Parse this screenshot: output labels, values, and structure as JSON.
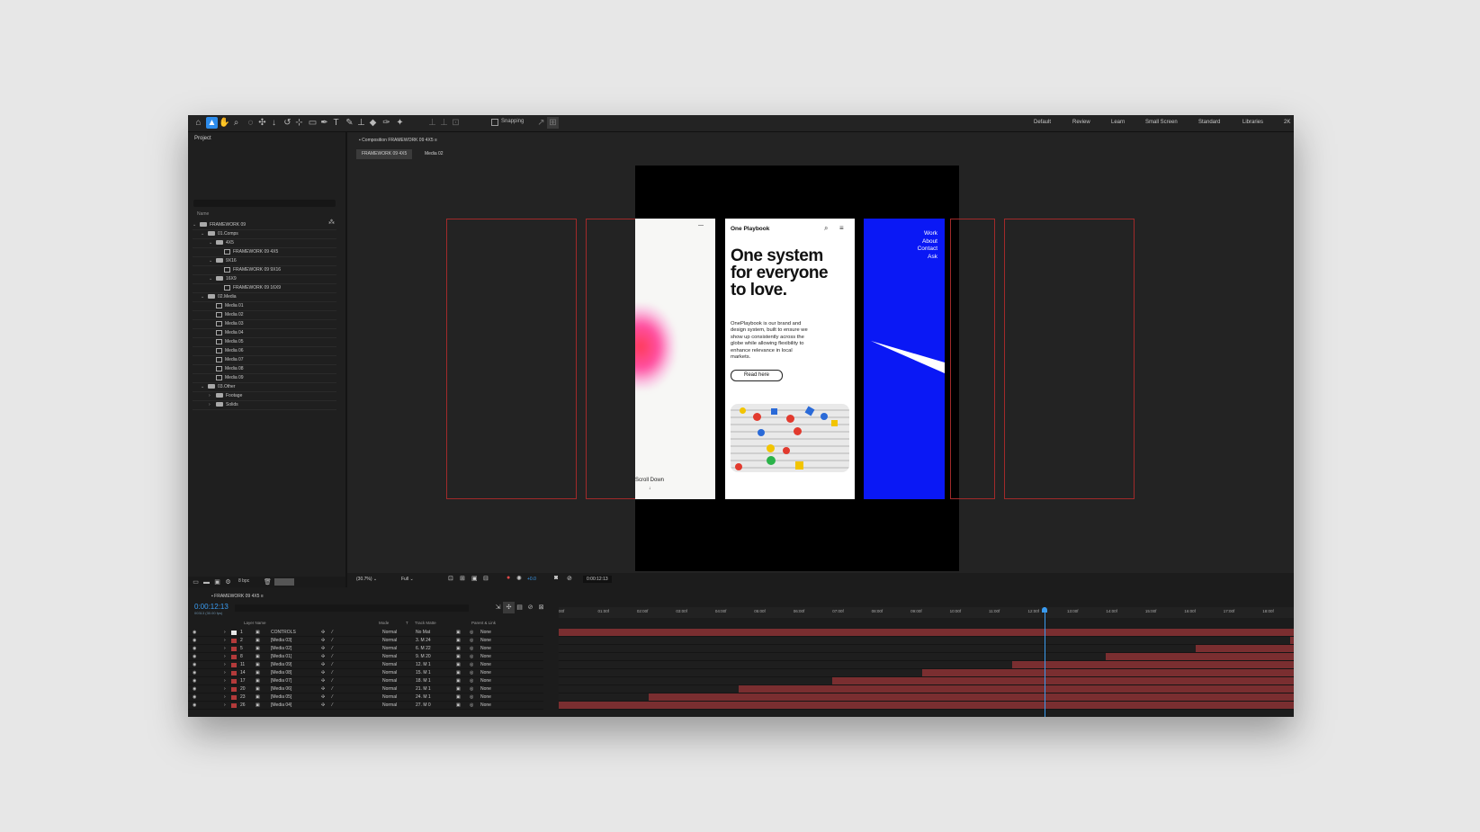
{
  "toolbar": {
    "snapping": "Snapping",
    "workspaces": [
      "Default",
      "Review",
      "Learn",
      "Small Screen",
      "Standard",
      "Libraries",
      "2K"
    ]
  },
  "project": {
    "title": "Project",
    "name_col": "Name",
    "tree": [
      {
        "label": "FRAMEWORK 09",
        "indent": 0,
        "type": "folder",
        "open": true
      },
      {
        "label": "01.Comps",
        "indent": 1,
        "type": "folder",
        "open": true
      },
      {
        "label": "4X5",
        "indent": 2,
        "type": "folder",
        "open": true
      },
      {
        "label": "FRAMEWORK 09 4X5",
        "indent": 3,
        "type": "comp"
      },
      {
        "label": "9X16",
        "indent": 2,
        "type": "folder",
        "open": true
      },
      {
        "label": "FRAMEWORK 09 9X16",
        "indent": 3,
        "type": "comp"
      },
      {
        "label": "16X9",
        "indent": 2,
        "type": "folder",
        "open": true
      },
      {
        "label": "FRAMEWORK 09 16X9",
        "indent": 3,
        "type": "comp"
      },
      {
        "label": "02.Media",
        "indent": 1,
        "type": "folder",
        "open": true
      },
      {
        "label": "Media 01",
        "indent": 2,
        "type": "comp"
      },
      {
        "label": "Media 02",
        "indent": 2,
        "type": "comp"
      },
      {
        "label": "Media 03",
        "indent": 2,
        "type": "comp"
      },
      {
        "label": "Media 04",
        "indent": 2,
        "type": "comp"
      },
      {
        "label": "Media 05",
        "indent": 2,
        "type": "comp"
      },
      {
        "label": "Media 06",
        "indent": 2,
        "type": "comp"
      },
      {
        "label": "Media 07",
        "indent": 2,
        "type": "comp"
      },
      {
        "label": "Media 08",
        "indent": 2,
        "type": "comp"
      },
      {
        "label": "Media 09",
        "indent": 2,
        "type": "comp"
      },
      {
        "label": "03.Other",
        "indent": 1,
        "type": "folder",
        "open": true
      },
      {
        "label": "Footage",
        "indent": 2,
        "type": "folder",
        "open": false
      },
      {
        "label": "Solids",
        "indent": 2,
        "type": "folder",
        "open": false
      }
    ],
    "bpc": "8 bpc"
  },
  "composition": {
    "tab": "Composition FRAMEWORK 09 4X5",
    "subtabs": [
      "FRAMEWORK 09 4X5",
      "Media 02"
    ],
    "zoom": "(30.7%)",
    "quality": "Full",
    "exposure": "+0.0",
    "timecode": "0:00:12:13"
  },
  "artwork": {
    "scroll_down": "Scroll Down",
    "brand": "One Playbook",
    "headline": [
      "One system",
      "for everyone",
      "to love."
    ],
    "body": [
      "OnePlaybook is our brand and",
      "design system, built to ensure we",
      "show up consistently across the",
      "globe while allowing flexibility to",
      "enhance relevance in local",
      "markets."
    ],
    "cta": "Read here",
    "menu": [
      "Work",
      "About",
      "Contact",
      "Ask"
    ],
    "blue": "#0a18f5"
  },
  "timeline": {
    "tab": "FRAMEWORK 09 4X5",
    "timecode": "0:00:12:13",
    "frames": "00313 (30.00 fps)",
    "headers": {
      "layer_name": "Layer Name",
      "mode": "Mode",
      "t": "T",
      "track_matte": "Track Matte",
      "parent": "Parent & Link"
    },
    "ruler": [
      "00f",
      "01:00f",
      "02:00f",
      "03:00f",
      "04:00f",
      "05:00f",
      "06:00f",
      "07:00f",
      "08:00f",
      "09:00f",
      "10:00f",
      "11:00f",
      "12:00f",
      "13:00f",
      "14:00f",
      "15:00f",
      "16:00f",
      "17:00f",
      "18:00f"
    ],
    "layers": [
      {
        "num": "1",
        "name": "CONTROLS",
        "mode": "Normal",
        "matte": "No Mat",
        "parent": "None"
      },
      {
        "num": "2",
        "name": "[Media 03]",
        "mode": "Normal",
        "matte": "3. M 24",
        "parent": "None"
      },
      {
        "num": "5",
        "name": "[Media 02]",
        "mode": "Normal",
        "matte": "6. M 22",
        "parent": "None"
      },
      {
        "num": "8",
        "name": "[Media 01]",
        "mode": "Normal",
        "matte": "9. M 20",
        "parent": "None"
      },
      {
        "num": "11",
        "name": "[Media 09]",
        "mode": "Normal",
        "matte": "12. M 1",
        "parent": "None"
      },
      {
        "num": "14",
        "name": "[Media 08]",
        "mode": "Normal",
        "matte": "15. M 1",
        "parent": "None"
      },
      {
        "num": "17",
        "name": "[Media 07]",
        "mode": "Normal",
        "matte": "18. M 1",
        "parent": "None"
      },
      {
        "num": "20",
        "name": "[Media 06]",
        "mode": "Normal",
        "matte": "21. M 1",
        "parent": "None"
      },
      {
        "num": "23",
        "name": "[Media 05]",
        "mode": "Normal",
        "matte": "24. M 1",
        "parent": "None"
      },
      {
        "num": "26",
        "name": "[Media 04]",
        "mode": "Normal",
        "matte": "27. M 0",
        "parent": "None"
      }
    ],
    "bar_starts": [
      0,
      18.7,
      16.3,
      14.0,
      11.6,
      9.3,
      7.0,
      4.6,
      2.3,
      0
    ],
    "playhead_s": 12.43,
    "duration_s": 18.8
  }
}
